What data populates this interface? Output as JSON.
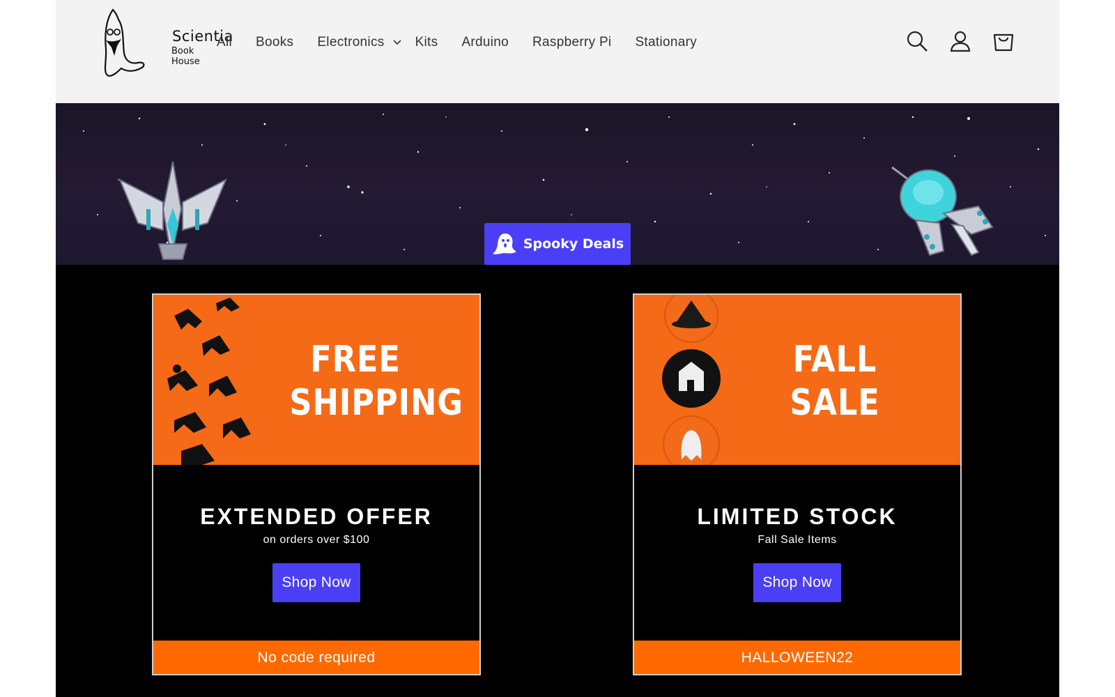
{
  "brand": {
    "name": "Scientia",
    "subtitle": "Book House"
  },
  "nav": {
    "items": [
      {
        "label": "All"
      },
      {
        "label": "Books"
      },
      {
        "label": "Electronics",
        "has_dropdown": true
      },
      {
        "label": "Kits"
      },
      {
        "label": "Arduino"
      },
      {
        "label": "Raspberry Pi"
      },
      {
        "label": "Stationary"
      }
    ]
  },
  "header_icons": [
    "search-icon",
    "account-icon",
    "cart-icon"
  ],
  "hero": {
    "button_label": "Spooky Deals"
  },
  "cards": [
    {
      "image_text": [
        "FREE",
        "SHIPPING"
      ],
      "title": "EXTENDED OFFER",
      "subtitle": "on orders over $100",
      "button": "Shop Now",
      "footer": "No code required"
    },
    {
      "image_text": [
        "FALL",
        "SALE"
      ],
      "title": "LIMITED STOCK",
      "subtitle": "Fall Sale Items",
      "button": "Shop Now",
      "footer": "HALLOWEEN22"
    }
  ],
  "colors": {
    "accent": "#4a3ff5",
    "orange": "#f56a16",
    "footer_orange": "#ff6a00",
    "header_bg": "#f3f3f3",
    "page_bg": "#000000"
  }
}
